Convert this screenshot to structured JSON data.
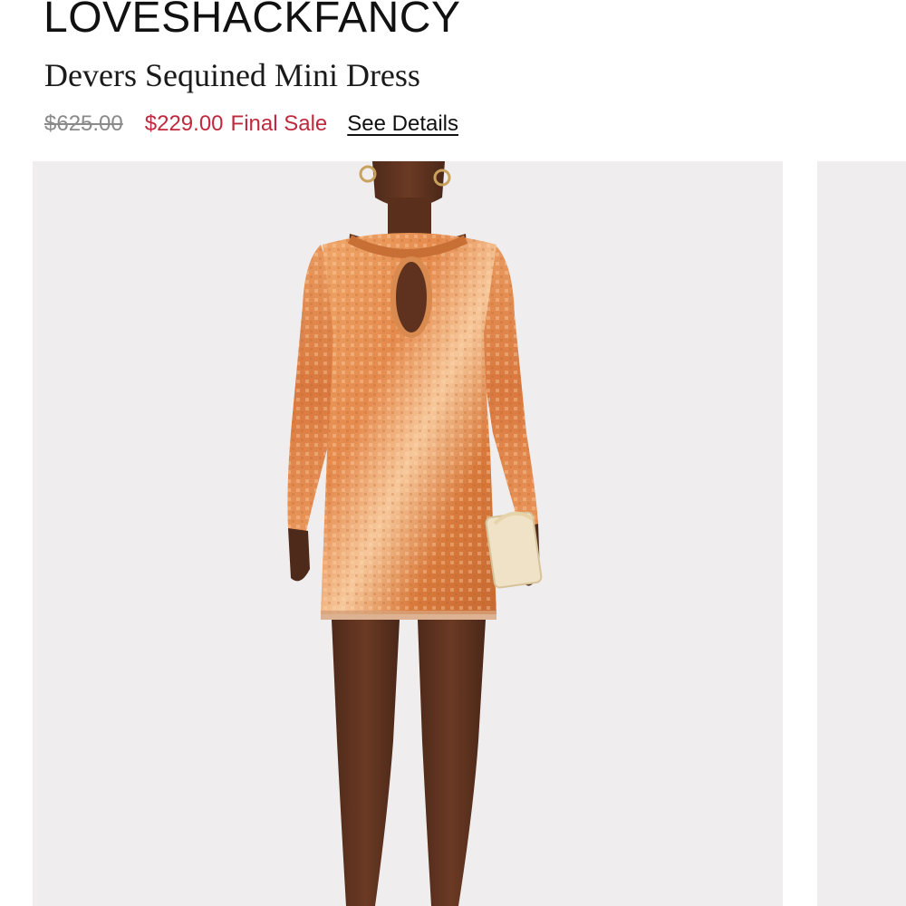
{
  "product": {
    "brand": "LOVESHACKFANCY",
    "name": "Devers Sequined Mini Dress"
  },
  "pricing": {
    "original_price": "$625.00",
    "sale_price": "$229.00",
    "sale_label": "Final Sale",
    "details_link": "See Details"
  },
  "gallery": {
    "images": [
      {
        "subject": "model wearing orange sequined mini dress holding clutch",
        "visible": "full"
      },
      {
        "subject": "next product image",
        "visible": "partial"
      }
    ]
  },
  "colors": {
    "sale_red": "#c0283d",
    "strike_gray": "#8a8a8a",
    "image_background": "#efedee",
    "dress_sequin": "#e8955a"
  }
}
